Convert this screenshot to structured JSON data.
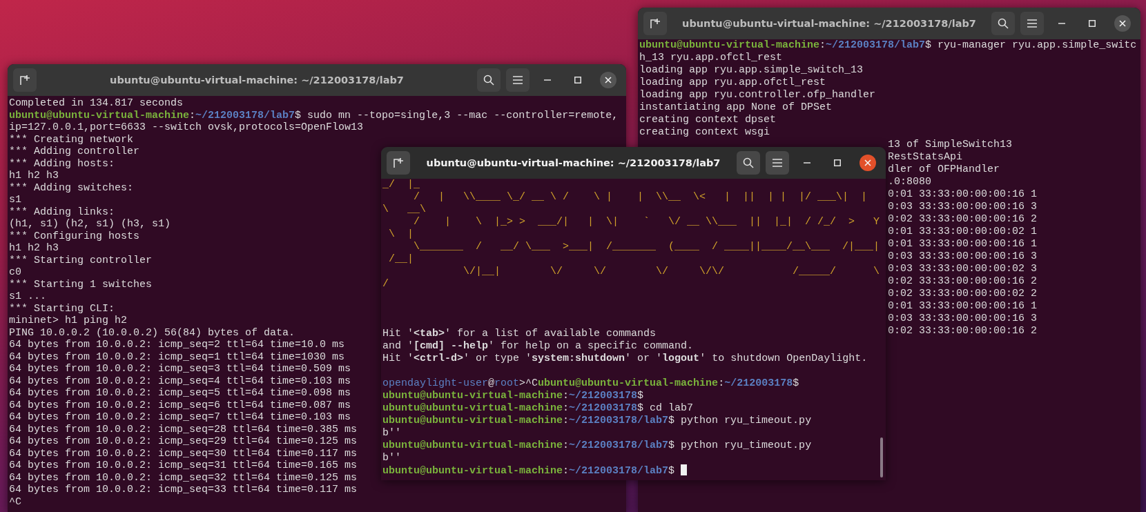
{
  "windows": [
    {
      "title": "ubuntu@ubuntu-virtual-machine: ~/212003178/lab7",
      "focused": false,
      "cursor": false,
      "sections": [
        {
          "kind": "plain",
          "lines": [
            "Completed in 134.817 seconds",
            [
              {
                "kind": "user",
                "text": "ubuntu@ubuntu-virtual-machine"
              },
              {
                "kind": "plain",
                "text": ":"
              },
              {
                "kind": "path",
                "text": "~/212003178/lab7"
              },
              {
                "kind": "plain",
                "text": "$ sudo mn --topo=single,3 --mac --controller=remote,"
              }
            ],
            "ip=127.0.0.1,port=6633 --switch ovsk,protocols=OpenFlow13",
            "*** Creating network",
            "*** Adding controller",
            "*** Adding hosts:",
            "h1 h2 h3",
            "*** Adding switches:",
            "s1",
            "*** Adding links:",
            "(h1, s1) (h2, s1) (h3, s1)",
            "*** Configuring hosts",
            "h1 h2 h3",
            "*** Starting controller",
            "c0",
            "*** Starting 1 switches",
            "s1 ...",
            "*** Starting CLI:",
            "mininet> h1 ping h2",
            "PING 10.0.0.2 (10.0.0.2) 56(84) bytes of data.",
            "64 bytes from 10.0.0.2: icmp_seq=2 ttl=64 time=10.0 ms",
            "64 bytes from 10.0.0.2: icmp_seq=1 ttl=64 time=1030 ms",
            "64 bytes from 10.0.0.2: icmp_seq=3 ttl=64 time=0.509 ms",
            "64 bytes from 10.0.0.2: icmp_seq=4 ttl=64 time=0.103 ms",
            "64 bytes from 10.0.0.2: icmp_seq=5 ttl=64 time=0.098 ms",
            "64 bytes from 10.0.0.2: icmp_seq=6 ttl=64 time=0.087 ms",
            "64 bytes from 10.0.0.2: icmp_seq=7 ttl=64 time=0.103 ms",
            "64 bytes from 10.0.0.2: icmp_seq=28 ttl=64 time=0.385 ms",
            "64 bytes from 10.0.0.2: icmp_seq=29 ttl=64 time=0.125 ms",
            "64 bytes from 10.0.0.2: icmp_seq=30 ttl=64 time=0.117 ms",
            "64 bytes from 10.0.0.2: icmp_seq=31 ttl=64 time=0.165 ms",
            "64 bytes from 10.0.0.2: icmp_seq=32 ttl=64 time=0.125 ms",
            "64 bytes from 10.0.0.2: icmp_seq=33 ttl=64 time=0.117 ms",
            "^C"
          ]
        }
      ]
    },
    {
      "title": "ubuntu@ubuntu-virtual-machine: ~/212003178/lab7",
      "focused": false,
      "cursor": false,
      "sections": [
        {
          "kind": "plain",
          "lines": [
            [
              {
                "kind": "user",
                "text": "ubuntu@ubuntu-virtual-machine"
              },
              {
                "kind": "plain",
                "text": ":"
              },
              {
                "kind": "path",
                "text": "~/212003178/lab7"
              },
              {
                "kind": "plain",
                "text": "$ ryu-manager ryu.app.simple_switc"
              }
            ],
            "h_13 ryu.app.ofctl_rest",
            "loading app ryu.app.simple_switch_13",
            "loading app ryu.app.ofctl_rest",
            "loading app ryu.controller.ofp_handler",
            "instantiating app None of DPSet",
            "creating context dpset",
            "creating context wsgi"
          ]
        },
        {
          "kind": "covered",
          "lines": [
            "13 of SimpleSwitch13",
            "RestStatsApi",
            "dler of OFPHandler",
            ".0:8080",
            "0:01 33:33:00:00:00:16 1",
            "0:03 33:33:00:00:00:16 3",
            "0:02 33:33:00:00:00:16 2",
            "0:01 33:33:00:00:00:02 1",
            "0:01 33:33:00:00:00:16 1",
            "0:03 33:33:00:00:00:16 3",
            "0:03 33:33:00:00:00:02 3",
            "0:02 33:33:00:00:00:16 2",
            "0:02 33:33:00:00:00:02 2",
            "0:01 33:33:00:00:00:16 1",
            "0:03 33:33:00:00:00:16 3",
            "0:02 33:33:00:00:00:16 2"
          ]
        }
      ]
    },
    {
      "title": "ubuntu@ubuntu-virtual-machine: ~/212003178/lab7",
      "focused": true,
      "cursor": true,
      "sections": [
        {
          "kind": "art",
          "lines": [
            "_/  |_",
            "     /   |   \\\\____ \\_/ __ \\ /    \\ |    |  \\\\__  \\<   |  ||  | |  |/ ___\\|  |",
            "\\   __\\",
            "     /    |    \\  |_> >  ___/|   |  \\|    `   \\/ __ \\\\___  ||  |_|  / /_/  >   Y",
            " \\  |",
            "     \\_______  /   __/ \\___  >___|  /_______  (____  / ____||____/__\\___  /|___|",
            " /__|",
            "             \\/|__|        \\/     \\/        \\/     \\/\\/           /_____/      \\",
            "/"
          ]
        },
        {
          "kind": "help",
          "lines": [
            "Hit '**<tab>**' for a list of available commands",
            "and '**[cmd] --help**' for help on a specific command.",
            "Hit '**<ctrl-d>**' or type '**system:shutdown**' or '**logout**' to shutdown OpenDaylight."
          ]
        },
        {
          "kind": "plain",
          "lines": [
            [
              {
                "kind": "odl",
                "text": "opendaylight-user"
              },
              {
                "kind": "plain",
                "text": "@"
              },
              {
                "kind": "odl",
                "text": "root"
              },
              {
                "kind": "plain",
                "text": ">^C"
              },
              {
                "kind": "user",
                "text": "ubuntu@ubuntu-virtual-machine"
              },
              {
                "kind": "plain",
                "text": ":"
              },
              {
                "kind": "path",
                "text": "~/212003178"
              },
              {
                "kind": "plain",
                "text": "$"
              }
            ],
            [
              {
                "kind": "user",
                "text": "ubuntu@ubuntu-virtual-machine"
              },
              {
                "kind": "plain",
                "text": ":"
              },
              {
                "kind": "path",
                "text": "~/212003178"
              },
              {
                "kind": "plain",
                "text": "$"
              }
            ],
            [
              {
                "kind": "user",
                "text": "ubuntu@ubuntu-virtual-machine"
              },
              {
                "kind": "plain",
                "text": ":"
              },
              {
                "kind": "path",
                "text": "~/212003178"
              },
              {
                "kind": "plain",
                "text": "$ cd lab7"
              }
            ],
            [
              {
                "kind": "user",
                "text": "ubuntu@ubuntu-virtual-machine"
              },
              {
                "kind": "plain",
                "text": ":"
              },
              {
                "kind": "path",
                "text": "~/212003178/lab7"
              },
              {
                "kind": "plain",
                "text": "$ python ryu_timeout.py"
              }
            ],
            "b''",
            [
              {
                "kind": "user",
                "text": "ubuntu@ubuntu-virtual-machine"
              },
              {
                "kind": "plain",
                "text": ":"
              },
              {
                "kind": "path",
                "text": "~/212003178/lab7"
              },
              {
                "kind": "plain",
                "text": "$ python ryu_timeout.py"
              }
            ],
            "b''",
            [
              {
                "kind": "user",
                "text": "ubuntu@ubuntu-virtual-machine"
              },
              {
                "kind": "plain",
                "text": ":"
              },
              {
                "kind": "path",
                "text": "~/212003178/lab7"
              },
              {
                "kind": "plain",
                "text": "$ "
              }
            ]
          ]
        }
      ]
    }
  ]
}
